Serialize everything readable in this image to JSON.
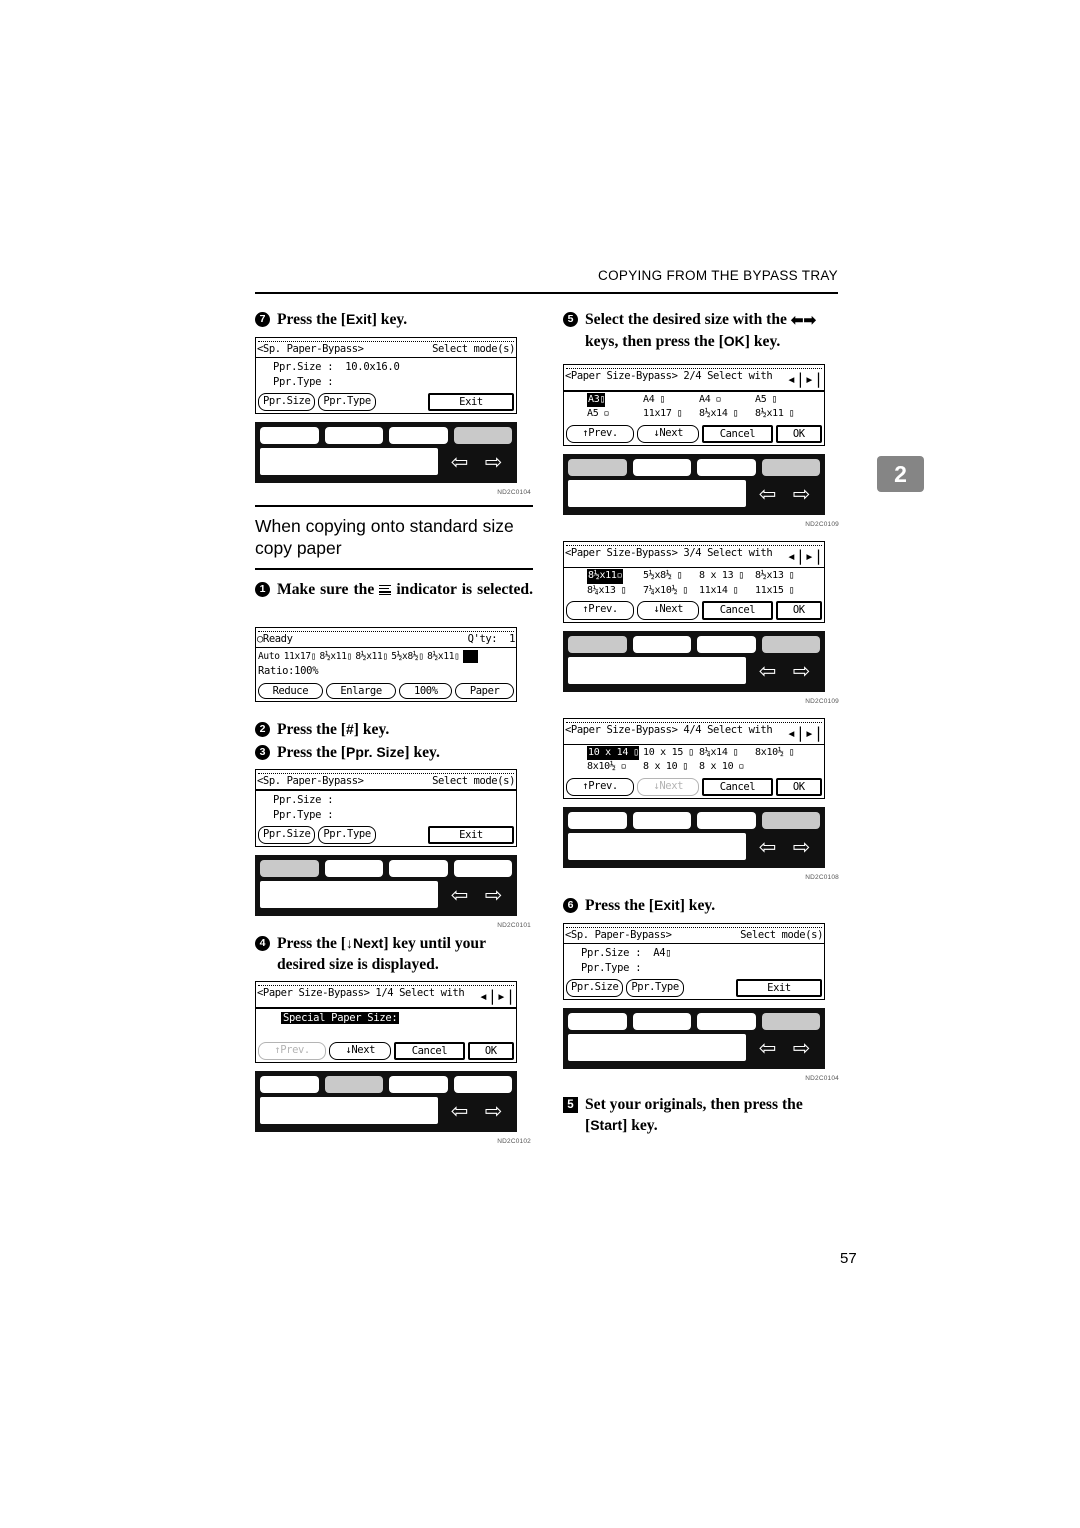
{
  "header": {
    "running_head": "COPYING FROM THE BYPASS TRAY",
    "chapter_tab": "2"
  },
  "page_number": "57",
  "section": {
    "title_line1": "When copying onto standard size",
    "title_line2": "copy paper"
  },
  "left_column": {
    "step7": {
      "num": "7",
      "text_pre": "Press the [",
      "key": "Exit",
      "text_post": "] key."
    },
    "fig_step7": {
      "code": "ND2C0104",
      "title_left": "<Sp. Paper-Bypass>",
      "title_right": "Select mode(s)",
      "line1_label": "Ppr.Size :",
      "line1_value": "10.0x16.0",
      "line2_label": "Ppr.Type :",
      "btn1": "Ppr.Size",
      "btn2": "Ppr.Type",
      "btn_exit": "Exit"
    },
    "step1": {
      "num": "1",
      "text_pre": "Make sure the",
      "text_post": "indicator is selected."
    },
    "fig_ready": {
      "code": "",
      "status": "Ready",
      "qty_label": "Q'ty:",
      "qty_value": "1",
      "mode": "Auto",
      "paper_sizes": [
        "11x17",
        "8½x11",
        "8½x11",
        "5½x8½",
        "8½x11"
      ],
      "ratio": "Ratio:100%",
      "btn1": "Reduce",
      "btn2": "Enlarge",
      "btn3": "100%",
      "btn4": "Paper"
    },
    "step2": {
      "num": "2",
      "text_pre": "Press the [",
      "key": "#",
      "text_post": "] key."
    },
    "step3": {
      "num": "3",
      "text_pre": "Press the [",
      "key": "Ppr. Size",
      "text_post": "] key."
    },
    "fig_step3": {
      "code": "ND2C0101",
      "title_left": "<Sp. Paper-Bypass>",
      "title_right": "Select mode(s)",
      "line1_label": "Ppr.Size :",
      "line1_value": "",
      "line2_label": "Ppr.Type :",
      "btn1": "Ppr.Size",
      "btn2": "Ppr.Type",
      "btn_exit": "Exit"
    },
    "step4": {
      "num": "4",
      "text_pre": "Press the [",
      "key": "↓Next",
      "text_post": "] key until your desired size is displayed."
    },
    "fig_step4": {
      "code": "ND2C0102",
      "title": "<Paper Size-Bypass> 1/4 Select with",
      "selected_label": "Special Paper Size:",
      "btn_prev": "↑Prev.",
      "btn_next": "↓Next",
      "btn_cancel": "Cancel",
      "btn_ok": "OK",
      "prev_disabled": true,
      "next_disabled": false
    }
  },
  "right_column": {
    "step5": {
      "num": "5",
      "text_pre": "Select the desired size with the",
      "text_mid": "keys, then press the [",
      "key": "OK",
      "text_post": "] key."
    },
    "fig_2of4": {
      "code": "ND2C0109",
      "title": "<Paper Size-Bypass> 2/4 Select with",
      "row1": [
        "A3",
        "A4",
        "A4",
        "A5"
      ],
      "row1_orient": [
        "land",
        "land",
        "port",
        "land"
      ],
      "row2": [
        "A5",
        "11x17",
        "8½x14",
        "8½x11"
      ],
      "row2_orient": [
        "port",
        "land",
        "land",
        "land"
      ],
      "selected": "A3",
      "btn_prev": "↑Prev.",
      "btn_next": "↓Next",
      "btn_cancel": "Cancel",
      "btn_ok": "OK"
    },
    "fig_3of4": {
      "code": "ND2C0109",
      "title": "<Paper Size-Bypass> 3/4 Select with",
      "row1": [
        "8½x11",
        "5½x8½",
        "8 x 13",
        "8½x13"
      ],
      "row1_orient": [
        "port",
        "land",
        "land",
        "land"
      ],
      "row2": [
        "8¼x13",
        "7¼x10½",
        "11x14",
        "11x15"
      ],
      "row2_orient": [
        "land",
        "land",
        "land",
        "land"
      ],
      "selected": "8½x11",
      "btn_prev": "↑Prev.",
      "btn_next": "↓Next",
      "btn_cancel": "Cancel",
      "btn_ok": "OK"
    },
    "fig_4of4": {
      "code": "ND2C0108",
      "title": "<Paper Size-Bypass> 4/4 Select with",
      "row1": [
        "10 x 14",
        "10 x 15",
        "8¼x14",
        "8x10½"
      ],
      "row1_orient": [
        "land",
        "land",
        "land",
        "land"
      ],
      "row2": [
        "8x10½",
        "8 x 10",
        "8 x 10",
        ""
      ],
      "row2_orient": [
        "port",
        "land",
        "port",
        ""
      ],
      "selected": "10 x 14",
      "btn_prev": "↑Prev.",
      "btn_next": "↓Next",
      "btn_cancel": "Cancel",
      "btn_ok": "OK",
      "next_disabled": true
    },
    "step6": {
      "num": "6",
      "text_pre": "Press the [",
      "key": "Exit",
      "text_post": "] key."
    },
    "fig_step6": {
      "code": "ND2C0104",
      "title_left": "<Sp. Paper-Bypass>",
      "title_right": "Select mode(s)",
      "line1_label": "Ppr.Size :",
      "line1_value": "A4",
      "line2_label": "Ppr.Type :",
      "btn1": "Ppr.Size",
      "btn2": "Ppr.Type",
      "btn_exit": "Exit"
    },
    "step5b": {
      "num": "5",
      "text_pre": "Set your originals, then press the [",
      "key": "Start",
      "text_post": "] key."
    }
  }
}
